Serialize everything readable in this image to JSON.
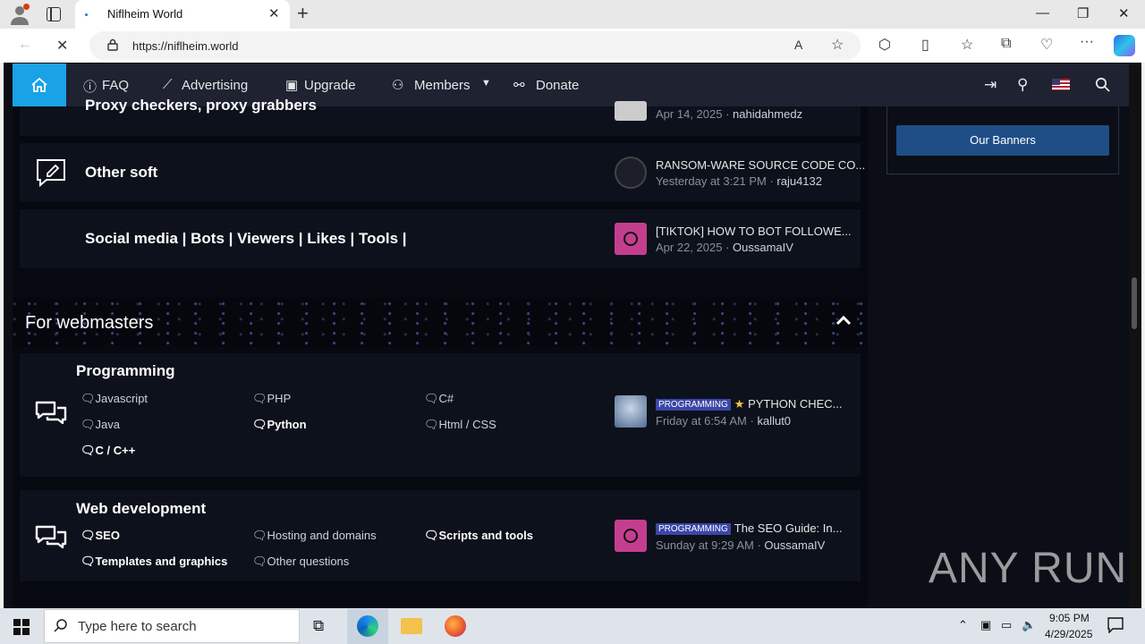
{
  "browser": {
    "tab_title": "Niflheim World",
    "url": "https://niflheim.world"
  },
  "nav": {
    "items": [
      {
        "label": "FAQ"
      },
      {
        "label": "Advertising"
      },
      {
        "label": "Upgrade"
      },
      {
        "label": "Members"
      },
      {
        "label": "Donate"
      }
    ]
  },
  "forums_top": [
    {
      "title": "Proxy checkers, proxy grabbers",
      "last_meta": "Apr 14, 2025",
      "last_user": "nahidahmedz"
    },
    {
      "title": "Other soft",
      "last_title": "RANSOM-WARE SOURCE CODE CO...",
      "last_meta": "Yesterday at 3:21 PM",
      "last_user": "raju4132"
    },
    {
      "title": "Social media | Bots | Viewers | Likes | Tools |",
      "last_title": "[TIKTOK] HOW TO BOT FOLLOWE...",
      "last_meta": "Apr 22, 2025",
      "last_user": "OussamaIV"
    }
  ],
  "category": {
    "title": "For webmasters"
  },
  "programming": {
    "title": "Programming",
    "subs": [
      "Javascript",
      "PHP",
      "C#",
      "Java",
      "Python",
      "Html / CSS",
      "C / C++"
    ],
    "tag": "PROGRAMMING",
    "last_title": "PYTHON CHEC...",
    "last_meta": "Friday at 6:54 AM",
    "last_user": "kallut0"
  },
  "webdev": {
    "title": "Web development",
    "subs": [
      "SEO",
      "Hosting and domains",
      "Scripts and tools",
      "Templates and graphics",
      "Other questions"
    ],
    "tag": "PROGRAMMING",
    "last_title": "The SEO Guide: In...",
    "last_meta": "Sunday at 9:29 AM",
    "last_user": "OussamaIV"
  },
  "sidebar": {
    "banners_button": "Our Banners"
  },
  "watermark": "ANY RUN",
  "taskbar": {
    "search_placeholder": "Type here to search",
    "time": "9:05 PM",
    "date": "4/29/2025"
  }
}
